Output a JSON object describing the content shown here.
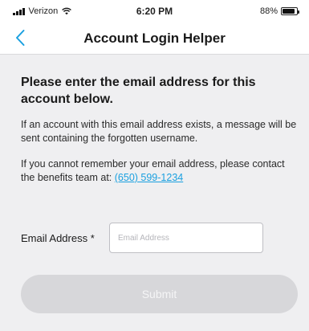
{
  "status_bar": {
    "carrier": "Verizon",
    "time": "6:20 PM",
    "battery_text": "88%",
    "battery_level": 0.88,
    "icons": [
      "signal-icon",
      "wifi-icon",
      "battery-icon"
    ]
  },
  "nav": {
    "back_icon": "chevron-left-icon",
    "title": "Account Login Helper"
  },
  "content": {
    "heading": "Please enter the email address for this account below.",
    "paragraph1": "If an account with this email address exists, a message will be sent containing the forgotten username.",
    "paragraph2_prefix": "If you cannot remember your email address, please contact the benefits team at: ",
    "phone": "(650) 599-1234"
  },
  "form": {
    "email_label": "Email Address *",
    "email_value": "",
    "email_placeholder": "Email Address",
    "submit_label": "Submit"
  },
  "colors": {
    "accent": "#1aa0e0",
    "background": "#efeff1",
    "button_disabled": "#d7d7da"
  }
}
